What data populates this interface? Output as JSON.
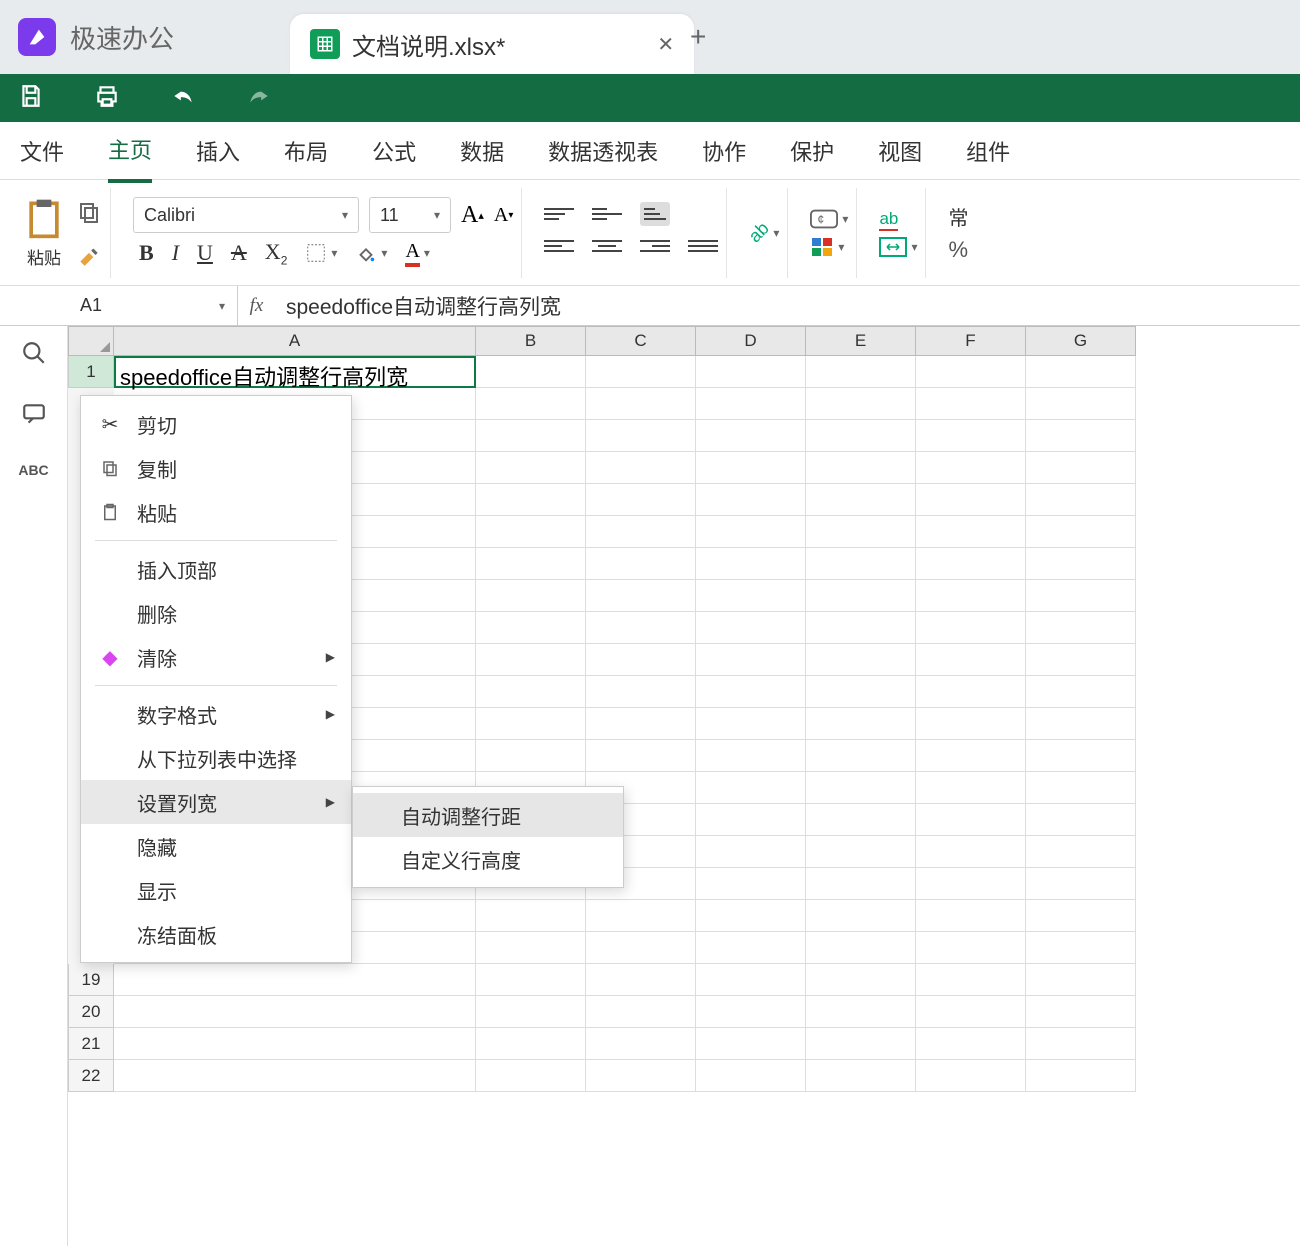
{
  "app": {
    "name": "极速办公"
  },
  "tab": {
    "title": "文档说明.xlsx*"
  },
  "menubar": {
    "items": [
      "文件",
      "主页",
      "插入",
      "布局",
      "公式",
      "数据",
      "数据透视表",
      "协作",
      "保护",
      "视图",
      "组件"
    ],
    "active_index": 1
  },
  "ribbon": {
    "paste_label": "粘贴",
    "font_name": "Calibri",
    "font_size": "11",
    "format_label": "常"
  },
  "formula": {
    "namebox": "A1",
    "fx": "fx",
    "value": "speedoffice自动调整行高列宽"
  },
  "sidebar_label": "ABC",
  "grid": {
    "columns": [
      "A",
      "B",
      "C",
      "D",
      "E",
      "F",
      "G"
    ],
    "rows": [
      "1",
      "19",
      "20",
      "21",
      "22"
    ],
    "a1_value": "speedoffice自动调整行高列宽"
  },
  "context_menu": {
    "items": [
      {
        "label": "剪切",
        "icon": "cut"
      },
      {
        "label": "复制",
        "icon": "copy"
      },
      {
        "label": "粘贴",
        "icon": "paste"
      },
      {
        "sep": true
      },
      {
        "label": "插入顶部"
      },
      {
        "label": "删除"
      },
      {
        "label": "清除",
        "icon": "eraser",
        "arrow": true
      },
      {
        "sep": true
      },
      {
        "label": "数字格式",
        "arrow": true
      },
      {
        "label": "从下拉列表中选择"
      },
      {
        "label": "设置列宽",
        "arrow": true,
        "active": true
      },
      {
        "label": "隐藏"
      },
      {
        "label": "显示"
      },
      {
        "label": "冻结面板"
      }
    ],
    "submenu": [
      {
        "label": "自动调整行距",
        "hl": true
      },
      {
        "label": "自定义行高度"
      }
    ]
  }
}
